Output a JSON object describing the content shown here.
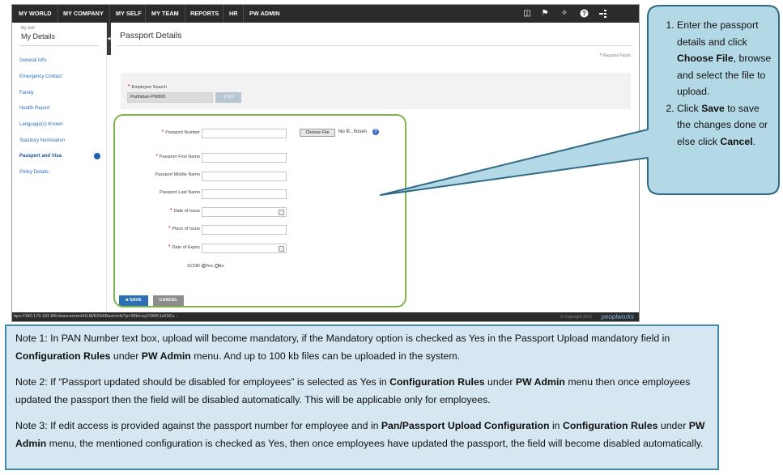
{
  "topnav": {
    "items": [
      "MY WORLD",
      "MY COMPANY",
      "MY SELF",
      "MY TEAM",
      "REPORTS",
      "HR",
      "PW ADMIN"
    ],
    "icons": [
      "book-icon",
      "flag-icon",
      "tools-icon",
      "help-icon",
      "share-icon"
    ]
  },
  "sidebar": {
    "breadcrumb_small": "My Self",
    "title": "My Details",
    "items": [
      "General Info.",
      "Emergency Contact",
      "Family",
      "Health Report",
      "Language(s) Known",
      "Statutory Nomination",
      "Passport and Visa",
      "Policy Details"
    ],
    "active": "Passport and Visa"
  },
  "content": {
    "title": "Passport Details",
    "required_note": "Required Fields",
    "employee_search_label": "Employee Search",
    "employee_search_value": "Parthiban-PW805",
    "go_label": "GO"
  },
  "form": {
    "passport_number": "Passport Number",
    "passport_first_name": "Passport First Name",
    "passport_middle_name": "Passport Middle Name",
    "passport_last_name": "Passport Last Name",
    "date_of_issue": "Date of Issue",
    "place_of_issue": "Place of Issue",
    "date_of_expiry": "Date of Expiry",
    "ecnr": "ECNR",
    "ecnr_yes": "Yes",
    "ecnr_no": "No",
    "choose_file": "Choose File",
    "no_file": "No fil...hosen",
    "save": "SAVE",
    "cancel": "CANCEL"
  },
  "statusbar": {
    "url": "ttps://180.179.182.8/Enhancement/HLM/EDM/BasicInfo?p=39b/coyC0WK1s53Zu...",
    "copyright": "© Copyright 2015",
    "brand": "peoplworks"
  },
  "callout": {
    "steps": [
      [
        "Enter the passport details and click ",
        "Choose File",
        ", browse and select the file to upload."
      ],
      [
        "Click ",
        "Save",
        " to save the changes done or else click ",
        "Cancel",
        "."
      ]
    ]
  },
  "notes": {
    "note1": [
      "Note 1: In PAN Number text box, upload will become mandatory, if the Mandatory option is checked as Yes in the Passport Upload mandatory field in ",
      "Configuration Rules",
      " under ",
      "PW Admin",
      " menu. And up to 100 kb files can be uploaded in the system."
    ],
    "note2": [
      "Note 2: If “Passport updated should be disabled for employees” is selected as Yes in ",
      "Configuration Rules",
      " under ",
      "PW Admin",
      " menu then once employees updated the passport then the field will be disabled automatically. This will be applicable only for employees."
    ],
    "note3": [
      "Note 3: If edit access is provided against the passport number for employee and in ",
      "Pan/Passport Upload Configuration",
      " in ",
      "Configuration Rules",
      " under ",
      "PW Admin",
      " menu, the mentioned configuration is checked as Yes, then once employees have updated the passport, the field will become disabled automatically."
    ]
  }
}
